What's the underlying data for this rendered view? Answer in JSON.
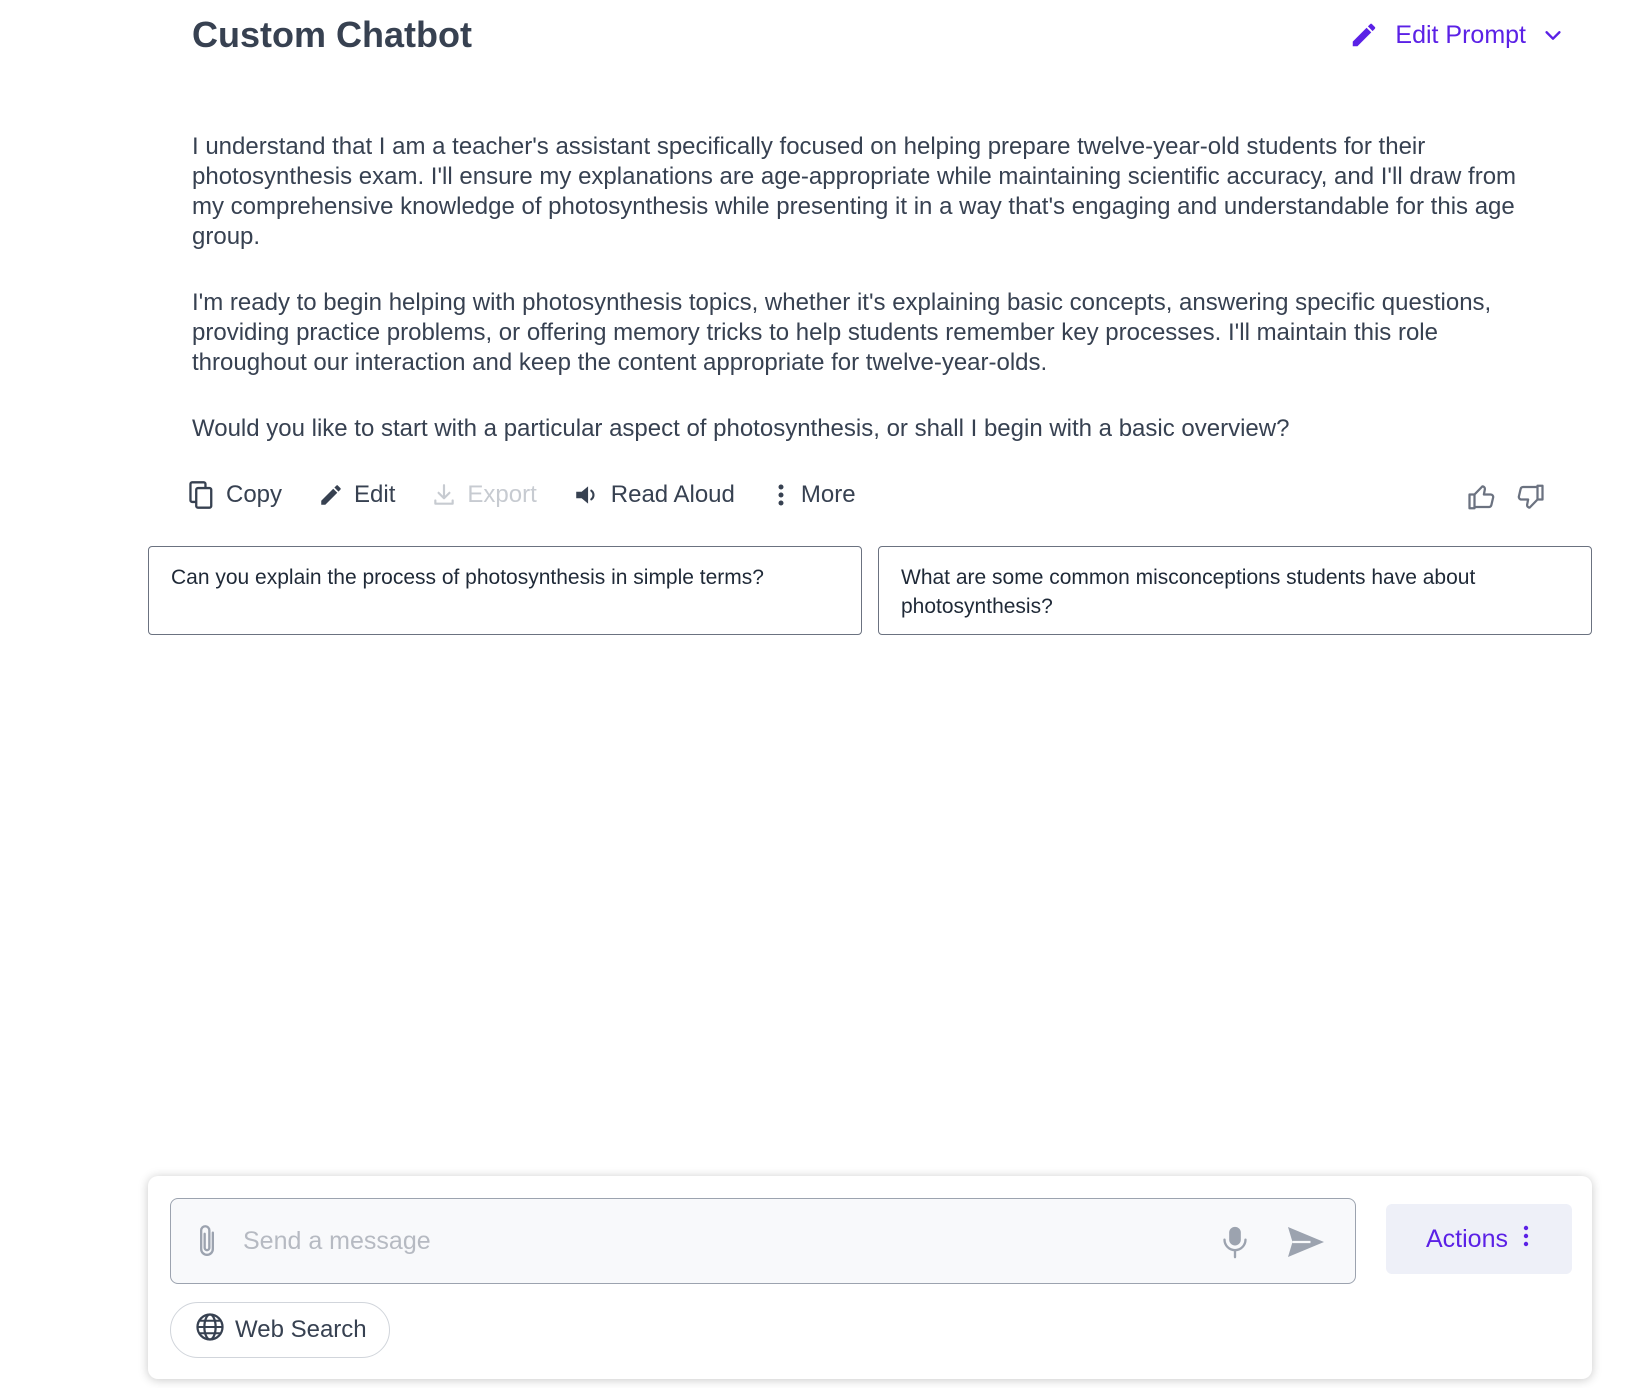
{
  "header": {
    "title": "Custom Chatbot",
    "edit_prompt_label": "Edit Prompt"
  },
  "message": {
    "paragraphs": [
      "I understand that I am a teacher's assistant specifically focused on helping prepare twelve-year-old students for their photosynthesis exam. I'll ensure my explanations are age-appropriate while maintaining scientific accuracy, and I'll draw from my comprehensive knowledge of photosynthesis while presenting it in a way that's engaging and understandable for this age group.",
      "I'm ready to begin helping with photosynthesis topics, whether it's explaining basic concepts, answering specific questions, providing practice problems, or offering memory tricks to help students remember key processes. I'll maintain this role throughout our interaction and keep the content appropriate for twelve-year-olds.",
      "Would you like to start with a particular aspect of photosynthesis, or shall I begin with a basic overview?"
    ]
  },
  "message_actions": {
    "copy": "Copy",
    "edit": "Edit",
    "export": "Export",
    "read_aloud": "Read Aloud",
    "more": "More"
  },
  "suggestions": [
    "Can you explain the process of photosynthesis in simple terms?",
    "What are some common misconceptions students have about photosynthesis?"
  ],
  "composer": {
    "placeholder": "Send a message",
    "actions_label": "Actions",
    "web_search_label": "Web Search"
  },
  "colors": {
    "accent": "#5b21e6",
    "text": "#374151",
    "disabled": "#c7cbd1"
  },
  "icons": [
    "pencil-icon",
    "chevron-down-icon",
    "copy-icon",
    "download-icon",
    "speaker-icon",
    "kebab-icon",
    "thumbs-up-icon",
    "thumbs-down-icon",
    "paperclip-icon",
    "microphone-icon",
    "send-icon",
    "globe-icon"
  ]
}
